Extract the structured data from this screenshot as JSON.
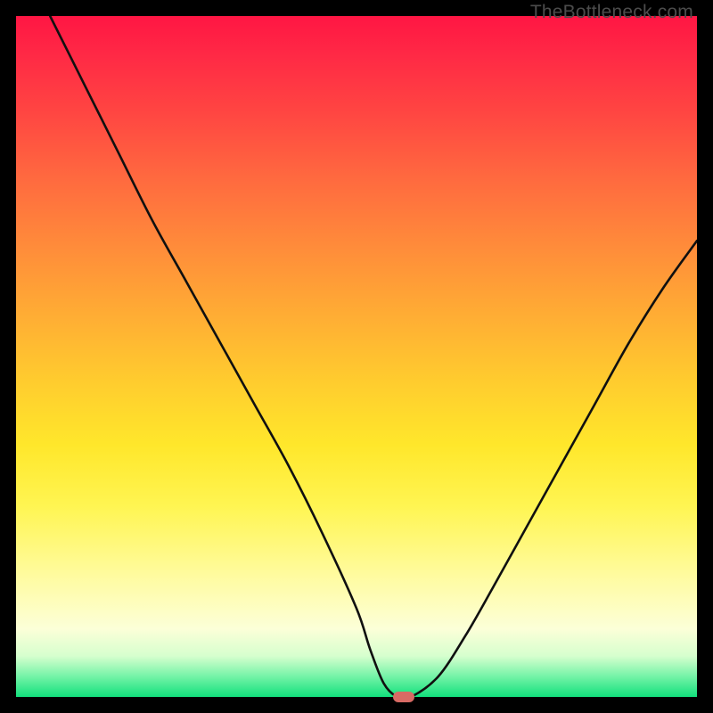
{
  "trademark": "TheBottleneck.com",
  "colors": {
    "frame": "#000000",
    "curve": "#101010",
    "marker": "#d86a64",
    "gradient_top": "#ff1644",
    "gradient_bottom": "#12e07c"
  },
  "chart_data": {
    "type": "line",
    "title": "",
    "xlabel": "",
    "ylabel": "",
    "xlim": [
      0,
      100
    ],
    "ylim": [
      0,
      100
    ],
    "grid": false,
    "legend": false,
    "series": [
      {
        "name": "bottleneck-curve",
        "x": [
          5,
          10,
          15,
          20,
          25,
          30,
          35,
          40,
          45,
          50,
          52,
          54,
          56,
          58,
          62,
          66,
          70,
          75,
          80,
          85,
          90,
          95,
          100
        ],
        "y": [
          100,
          90,
          80,
          70,
          61,
          52,
          43,
          34,
          24,
          13,
          7,
          2,
          0,
          0,
          3,
          9,
          16,
          25,
          34,
          43,
          52,
          60,
          67
        ]
      }
    ],
    "marker": {
      "x": 57,
      "y": 0
    },
    "annotations": []
  }
}
